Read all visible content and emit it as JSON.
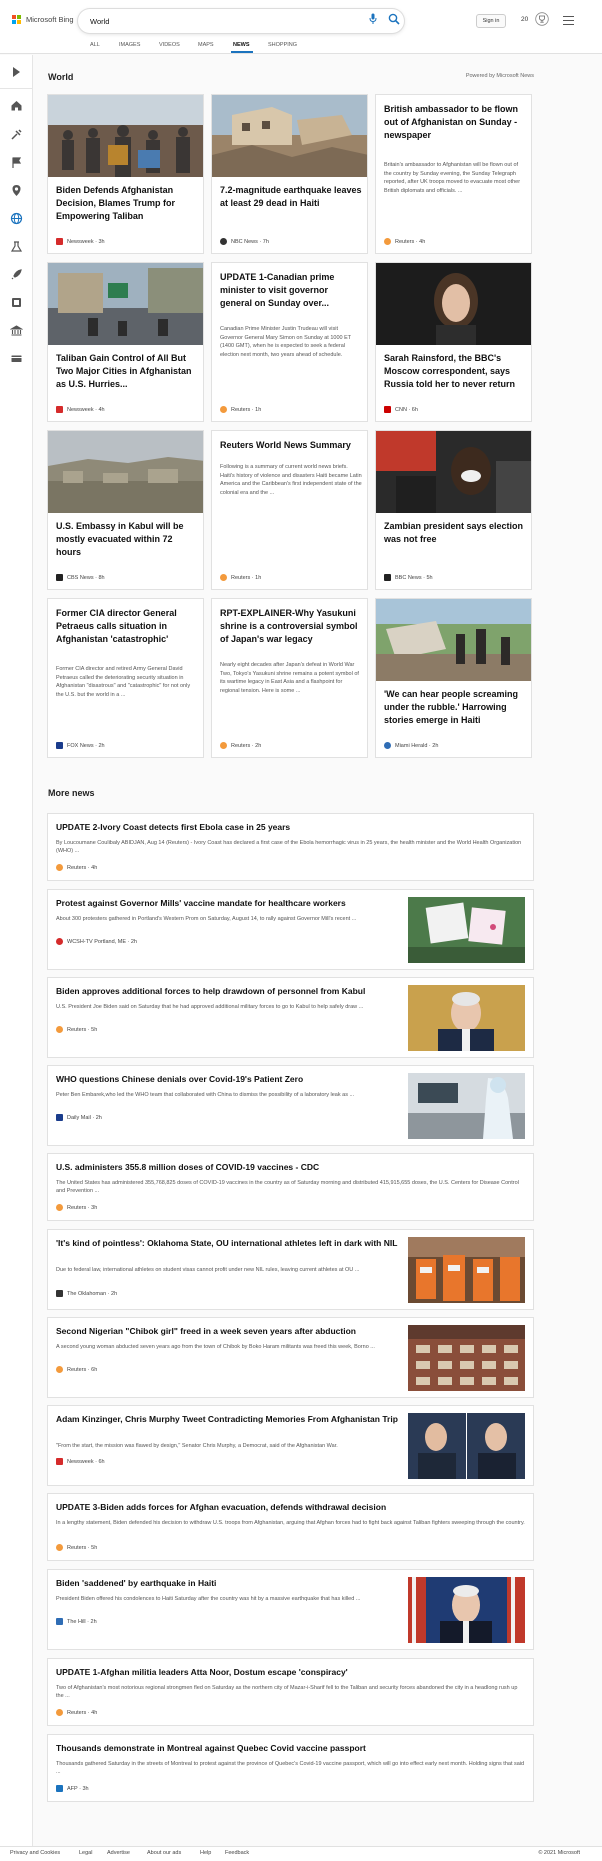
{
  "header": {
    "brand": "Microsoft Bing",
    "search_value": "World",
    "signin": "Sign in",
    "rewards_count": "20",
    "tabs": [
      "ALL",
      "IMAGES",
      "VIDEOS",
      "MAPS",
      "NEWS",
      "SHOPPING"
    ],
    "active_tab": "NEWS"
  },
  "section": {
    "title": "World",
    "powered": "Powered by Microsoft News"
  },
  "cards": [
    {
      "title": "Biden Defends Afghanistan Decision, Blames Trump for Empowering Taliban",
      "source": "Newsweek · 3h",
      "color": "#d52b2b"
    },
    {
      "title": "7.2-magnitude earthquake leaves at least 29 dead in Haiti",
      "source": "NBC News · 7h",
      "color": "#333"
    },
    {
      "title": "British ambassador to be flown out of Afghanistan on Sunday - newspaper",
      "desc": "Britain's ambassador to Afghanistan will be flown out of the country by Sunday evening, the Sunday Telegraph reported, after UK troops moved to evacuate most other British diplomats and officials. ...",
      "source": "Reuters · 4h",
      "color": "#f39a3c"
    },
    {
      "title": "Taliban Gain Control of All But Two Major Cities in Afghanistan as U.S. Hurries...",
      "source": "Newsweek · 4h",
      "color": "#d52b2b"
    },
    {
      "title": "UPDATE 1-Canadian prime minister to visit governor general on Sunday over...",
      "desc": "Canadian Prime Minister Justin Trudeau will visit Governor General Mary Simon on Sunday at 1000 ET (1400 GMT), when he is expected to seek a federal election next month, two years ahead of schedule.",
      "source": "Reuters · 1h",
      "color": "#f39a3c"
    },
    {
      "title": "Sarah Rainsford, the BBC's Moscow correspondent, says Russia told her to never return",
      "source": "CNN · 6h",
      "color": "#cc0000"
    },
    {
      "title": "U.S. Embassy in Kabul will be mostly evacuated within 72 hours",
      "source": "CBS News · 8h",
      "color": "#222"
    },
    {
      "title": "Reuters World News Summary",
      "desc": "Following is a summary of current world news briefs. Haiti's history of violence and disasters Haiti became Latin America and the Caribbean's first independent state of the colonial era and the ...",
      "source": "Reuters · 1h",
      "color": "#f39a3c"
    },
    {
      "title": "Zambian president says election was not free",
      "source": "BBC News · 5h",
      "color": "#222"
    },
    {
      "title": "Former CIA director General Petraeus calls situation in Afghanistan 'catastrophic'",
      "desc": "Former CIA director and retired Army General David Petraeus called the deteriorating security situation in Afghanistan \"disastrous\" and \"catastrophic\" for not only the U.S. but the world in a ...",
      "source": "FOX News · 2h",
      "color": "#1a3c8c"
    },
    {
      "title": "RPT-EXPLAINER-Why Yasukuni shrine is a controversial symbol of Japan's war legacy",
      "desc": "Nearly eight decades after Japan's defeat in World War Two, Tokyo's Yasukuni shrine remains a potent symbol of its wartime legacy in East Asia and a flashpoint for regional tension. Here is some ...",
      "source": "Reuters · 2h",
      "color": "#f39a3c"
    },
    {
      "title": "'We can hear people screaming under the rubble.' Harrowing stories emerge in Haiti",
      "source": "Miami Herald · 2h",
      "color": "#2f6db5"
    }
  ],
  "more": {
    "title": "More news",
    "items": [
      {
        "title": "UPDATE 2-Ivory Coast detects first Ebola case in 25 years",
        "desc": "By Loucoumane Coulibaly ABIDJAN, Aug 14 (Reuters) - Ivory Coast has declared a first case of the Ebola hemorrhagic virus in 25 years, the health minister and the World Health Organization (WHO) ...",
        "source": "Reuters · 4h",
        "color": "#f39a3c"
      },
      {
        "title": "Protest against Governor Mills' vaccine mandate for healthcare workers",
        "desc": "About 300 protesters gathered in Portland's Western Prom on Saturday, August 14, to rally against Governor Mill's recent ...",
        "source": "WCSH-TV Portland, ME · 2h",
        "color": "#d52b2b"
      },
      {
        "title": "Biden approves additional forces to help drawdown of personnel from Kabul",
        "desc": "U.S. President Joe Biden said on Saturday that he had approved additional military forces to go to Kabul to help safely draw ...",
        "source": "Reuters · 5h",
        "color": "#f39a3c"
      },
      {
        "title": "WHO questions Chinese denials over Covid-19's Patient Zero",
        "desc": "Peter Ben Embarek,who led the WHO team that collaborated with China to dismiss the possibility of a laboratory leak as ...",
        "source": "Daily Mail · 2h",
        "color": "#1a3c8c"
      },
      {
        "title": "U.S. administers 355.8 million doses of COVID-19 vaccines - CDC",
        "desc": "The United States has administered 355,768,825 doses of COVID-19 vaccines in the country as of Saturday morning and distributed 415,915,655 doses, the U.S. Centers for Disease Control and Prevention ...",
        "source": "Reuters · 3h",
        "color": "#f39a3c"
      },
      {
        "title": "'It's kind of pointless': Oklahoma State, OU international athletes left in dark with NIL",
        "desc": "Due to federal law, international athletes on student visas cannot profit under new NIL rules, leaving current athletes at OU ...",
        "source": "The Oklahoman · 2h",
        "color": "#333"
      },
      {
        "title": "Second Nigerian \"Chibok girl\" freed in a week seven years after abduction",
        "desc": "A second young woman abducted seven years ago from the town of Chibok by Boko Haram militants was freed this week, Borno ...",
        "source": "Reuters · 6h",
        "color": "#f39a3c"
      },
      {
        "title": "Adam Kinzinger, Chris Murphy Tweet Contradicting Memories From Afghanistan Trip",
        "desc": "\"From the start, the mission was flawed by design,\" Senator Chris Murphy, a Democrat, said of the Afghanistan War.",
        "source": "Newsweek · 6h",
        "color": "#d52b2b"
      },
      {
        "title": "UPDATE 3-Biden adds forces for Afghan evacuation, defends withdrawal decision",
        "desc": "In a lengthy statement, Biden defended his decision to withdraw U.S. troops from Afghanistan, arguing that Afghan forces had to fight back against Taliban fighters sweeping through the country.",
        "source": "Reuters · 5h",
        "color": "#f39a3c"
      },
      {
        "title": "Biden 'saddened' by earthquake in Haiti",
        "desc": "President Biden offered his condolences to Haiti Saturday after the country was hit by a massive earthquake that has killed ...",
        "source": "The Hill · 2h",
        "color": "#2f6db5"
      },
      {
        "title": "UPDATE 1-Afghan militia leaders Atta Noor, Dostum escape 'conspiracy'",
        "desc": "Two of Afghanistan's most notorious regional strongmen fled on Saturday as the northern city of Mazar-i-Sharif fell to the Taliban and security forces abandoned the city in a headlong rush up the ...",
        "source": "Reuters · 4h",
        "color": "#f39a3c"
      },
      {
        "title": "Thousands demonstrate in Montreal against Quebec Covid vaccine passport",
        "desc": "Thousands gathered Saturday in the streets of Montreal to protest against the province of Quebec's Covid-19 vaccine passport, which will go into effect early next month. Holding signs that said ...",
        "source": "AFP · 3h",
        "color": "#1b73be"
      }
    ]
  },
  "footer": {
    "links": [
      "Privacy and Cookies",
      "Legal",
      "Advertise",
      "About our ads",
      "Help",
      "Feedback"
    ],
    "copyright": "© 2021 Microsoft"
  },
  "colors": {
    "accent": "#1b73be",
    "brand_red": "#f25022",
    "brand_green": "#7fba00",
    "brand_blue": "#00a4ef",
    "brand_yellow": "#ffb900"
  }
}
